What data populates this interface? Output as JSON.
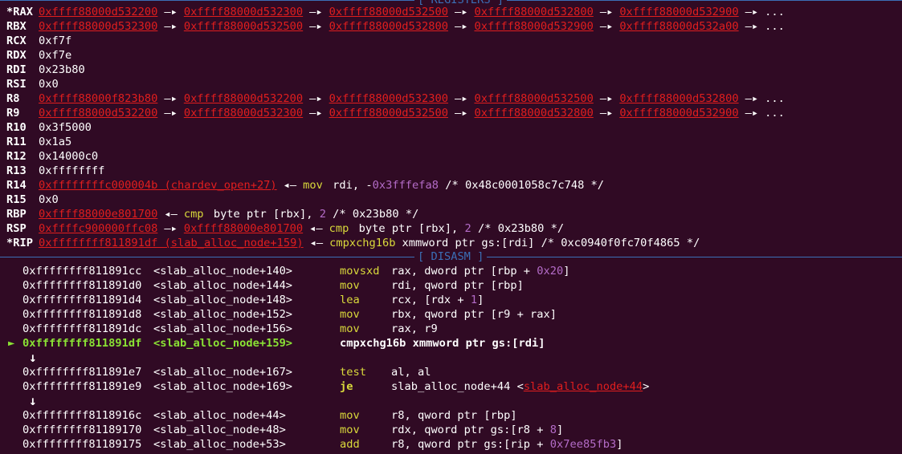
{
  "registers_header": "[ REGISTERS ]",
  "disasm_header": "[ DISASM ]",
  "arrow": "—▸",
  "ellipsis": "...",
  "registers": [
    {
      "name": "*RAX",
      "chain": [
        "0xffff88000d532200",
        "0xffff88000d532300",
        "0xffff88000d532500",
        "0xffff88000d532800",
        "0xffff88000d532900"
      ],
      "tail": "..."
    },
    {
      "name": "RBX",
      "chain": [
        "0xffff88000d532300",
        "0xffff88000d532500",
        "0xffff88000d532800",
        "0xffff88000d532900",
        "0xffff88000d532a00"
      ],
      "tail": "..."
    },
    {
      "name": "RCX",
      "value": "0xf7f"
    },
    {
      "name": "RDX",
      "value": "0xf7e"
    },
    {
      "name": "RDI",
      "value": "0x23b80"
    },
    {
      "name": "RSI",
      "value": "0x0"
    },
    {
      "name": "R8",
      "chain": [
        "0xffff88000f823b80",
        "0xffff88000d532200",
        "0xffff88000d532300",
        "0xffff88000d532500",
        "0xffff88000d532800"
      ],
      "tail": "..."
    },
    {
      "name": "R9",
      "chain": [
        "0xffff88000d532200",
        "0xffff88000d532300",
        "0xffff88000d532500",
        "0xffff88000d532800",
        "0xffff88000d532900"
      ],
      "tail": "..."
    },
    {
      "name": "R10",
      "value": "0x3f5000"
    },
    {
      "name": "R11",
      "value": "0x1a5"
    },
    {
      "name": "R12",
      "value": "0x14000c0"
    },
    {
      "name": "R13",
      "value": "0xffffffff"
    },
    {
      "name": "R14",
      "ptr": "0xffffffffc000004b (chardev_open+27)",
      "ins_mn": "mov",
      "ins_pre": "rdi, -",
      "ins_imm": "0x3fffefa8",
      "ins_post": " /* 0x48c0001058c7c748 */"
    },
    {
      "name": "R15",
      "value": "0x0"
    },
    {
      "name": "RBP",
      "ptr": "0xffff88000e801700",
      "ins_mn": "cmp",
      "ins_pre": "byte ptr [rbx], ",
      "ins_imm": "2",
      "ins_post": " /* 0x23b80 */"
    },
    {
      "name": "RSP",
      "ptr": "0xffffc900000ffc08",
      "ptr2": "0xffff88000e801700",
      "ins_mn": "cmp",
      "ins_pre": "byte ptr [rbx], ",
      "ins_imm": "2",
      "ins_post": " /* 0x23b80 */"
    },
    {
      "name": "*RIP",
      "ptr": "0xffffffff811891df (slab_alloc_node+159)",
      "ins_mn": "cmpxchg16b",
      "ins_pre": "xmmword ptr gs:[rdi]",
      "ins_imm": "",
      "ins_post": " /* 0xc0940f0fc70f4865 */"
    }
  ],
  "disasm": [
    {
      "addr": "0xffffffff811891cc",
      "sym": "<slab_alloc_node+140>",
      "mn": "movsxd",
      "ops_pre": "rax, dword ptr [rbp + ",
      "imm": "0x20",
      "ops_post": "]"
    },
    {
      "addr": "0xffffffff811891d0",
      "sym": "<slab_alloc_node+144>",
      "mn": "mov",
      "ops_pre": "rdi, qword ptr [rbp]",
      "imm": "",
      "ops_post": ""
    },
    {
      "addr": "0xffffffff811891d4",
      "sym": "<slab_alloc_node+148>",
      "mn": "lea",
      "ops_pre": "rcx, [rdx + ",
      "imm": "1",
      "ops_post": "]"
    },
    {
      "addr": "0xffffffff811891d8",
      "sym": "<slab_alloc_node+152>",
      "mn": "mov",
      "ops_pre": "rbx, qword ptr [r9 + rax]",
      "imm": "",
      "ops_post": ""
    },
    {
      "addr": "0xffffffff811891dc",
      "sym": "<slab_alloc_node+156>",
      "mn": "mov",
      "ops_pre": "rax, r9",
      "imm": "",
      "ops_post": ""
    },
    {
      "addr": "0xffffffff811891df",
      "sym": "<slab_alloc_node+159>",
      "mn": "cmpxchg16b",
      "ops_pre": "xmmword ptr gs:[rdi]",
      "imm": "",
      "ops_post": "",
      "current": true,
      "marker": "►",
      "jump_after": "↓"
    },
    {
      "addr": "0xffffffff811891e7",
      "sym": "<slab_alloc_node+167>",
      "mn": "test",
      "ops_pre": "al, al",
      "imm": "",
      "ops_post": ""
    },
    {
      "addr": "0xffffffff811891e9",
      "sym": "<slab_alloc_node+169>",
      "mn": "je",
      "ops_pre": "slab_alloc_node+44 <",
      "target": "slab_alloc_node+44",
      "ops_post": ">",
      "jump_after": "↓",
      "jump_mn": true
    },
    {
      "addr": "0xffffffff8118916c",
      "sym": "<slab_alloc_node+44>",
      "mn": "mov",
      "ops_pre": "r8, qword ptr [rbp]",
      "imm": "",
      "ops_post": ""
    },
    {
      "addr": "0xffffffff81189170",
      "sym": "<slab_alloc_node+48>",
      "mn": "mov",
      "ops_pre": "rdx, qword ptr gs:[r8 + ",
      "imm": "8",
      "ops_post": "]"
    },
    {
      "addr": "0xffffffff81189175",
      "sym": "<slab_alloc_node+53>",
      "mn": "add",
      "ops_pre": "r8, qword ptr gs:[rip + ",
      "imm": "0x7ee85fb3",
      "ops_post": "]"
    }
  ]
}
